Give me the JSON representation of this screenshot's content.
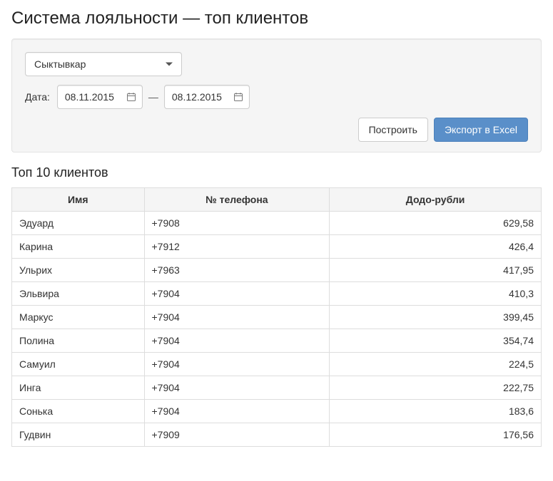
{
  "page_title": "Система лояльности — топ клиентов",
  "filters": {
    "city_select": {
      "value": "Сыктывкар"
    },
    "date_label": "Дата:",
    "date_from": "08.11.2015",
    "date_sep": "—",
    "date_to": "08.12.2015"
  },
  "actions": {
    "build_label": "Построить",
    "export_label": "Экспорт в Excel"
  },
  "subtitle": "Топ 10 клиентов",
  "table": {
    "headers": {
      "name": "Имя",
      "phone": "№ телефона",
      "points": "Додо-рубли"
    },
    "rows": [
      {
        "name": "Эдуард",
        "phone": "+7908",
        "points": "629,58"
      },
      {
        "name": "Карина",
        "phone": "+7912",
        "points": "426,4"
      },
      {
        "name": "Ульрих",
        "phone": "+7963",
        "points": "417,95"
      },
      {
        "name": "Эльвира",
        "phone": "+7904",
        "points": "410,3"
      },
      {
        "name": "Маркус",
        "phone": "+7904",
        "points": "399,45"
      },
      {
        "name": "Полина",
        "phone": "+7904",
        "points": "354,74"
      },
      {
        "name": "Самуил",
        "phone": "+7904",
        "points": "224,5"
      },
      {
        "name": "Инга",
        "phone": "+7904",
        "points": "222,75"
      },
      {
        "name": "Сонька",
        "phone": "+7904",
        "points": "183,6"
      },
      {
        "name": "Гудвин",
        "phone": "+7909",
        "points": "176,56"
      }
    ]
  }
}
